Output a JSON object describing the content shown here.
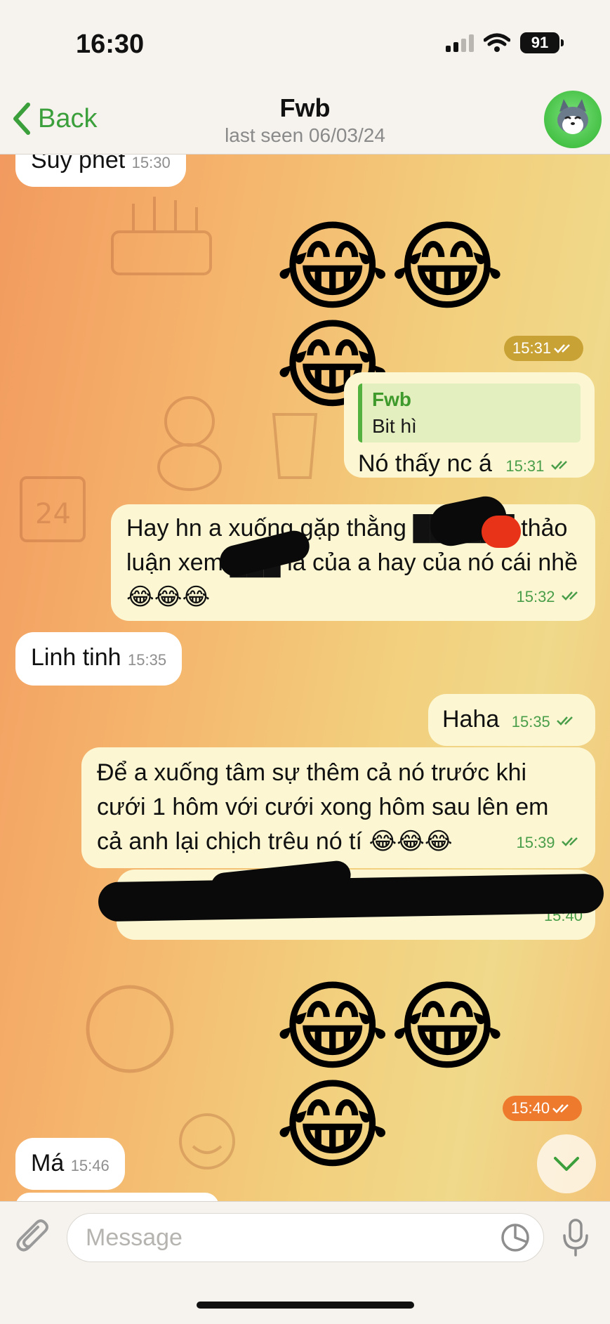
{
  "status_bar": {
    "time": "16:30",
    "battery": "91"
  },
  "nav": {
    "back_label": "Back",
    "title": "Fwb",
    "subtitle": "last seen 06/03/24"
  },
  "messages": {
    "top_partial": {
      "text": "Suy phết",
      "time": "15:30"
    },
    "emoji_row_1": {
      "emoji": "😂😂😂",
      "time": "15:31"
    },
    "reply_msg": {
      "reply_name": "Fwb",
      "reply_text": "Bit hì",
      "text": "Nó thấy nc á",
      "time": "15:31"
    },
    "msg_hay": {
      "text": "Hay hn a xuống gặp thằng ██████ thảo luận xem ███ là của a hay của nó cái nhề😂😂😂",
      "time": "15:32"
    },
    "msg_linh": {
      "text": "Linh tinh",
      "time": "15:35"
    },
    "msg_haha": {
      "text": "Haha",
      "time": "15:35"
    },
    "msg_de": {
      "text": "Để a xuống tâm sự thêm cả nó trước khi cưới 1 hôm với cưới xong hôm sau lên em cả anh lại chịch trêu nó tí 😂😂😂",
      "time": "15:39"
    },
    "msg_redacted": {
      "text": "",
      "time": "15:40"
    },
    "emoji_row_2": {
      "emoji": "😂😂😂",
      "time": "15:40"
    },
    "msg_ma": {
      "text": "Má",
      "time": "15:46"
    }
  },
  "input": {
    "placeholder": "Message"
  },
  "colors": {
    "accent_green": "#3b9f3b",
    "outgoing_bubble": "#fcf7d2",
    "incoming_bubble": "#ffffff",
    "time_pill_1": "#c9a236",
    "time_pill_2": "#ee7a2e"
  },
  "icons": [
    "back-chevron-icon",
    "avatar-husky-icon",
    "chevron-down-icon",
    "paperclip-icon",
    "sticker-icon",
    "microphone-icon",
    "double-check-icon"
  ]
}
